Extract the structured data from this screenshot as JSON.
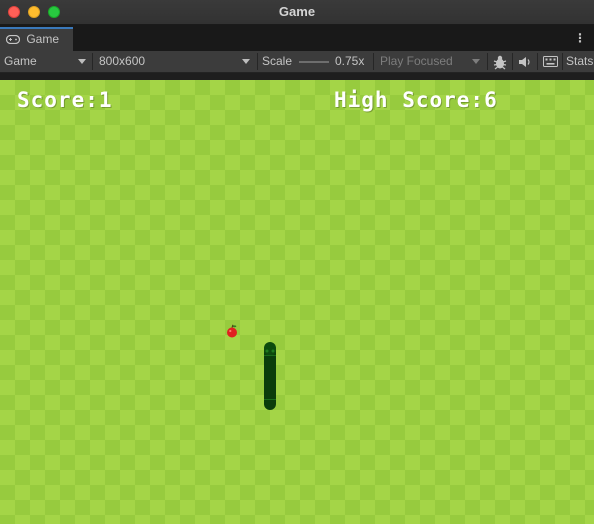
{
  "window": {
    "title": "Game"
  },
  "tabs": [
    {
      "label": "Game",
      "icon": "gamepad-icon"
    }
  ],
  "toolbar": {
    "display_selected": "Game",
    "resolution_selected": "800x600",
    "scale_label": "Scale",
    "scale_value": "0.75x",
    "play_mode_selected": "Play Focused",
    "stats_label": "Stats"
  },
  "game": {
    "score_text": "Score:1",
    "high_score_text": "High Score:6",
    "score": 1,
    "high_score": 6
  },
  "colors": {
    "grass_light": "#a4d547",
    "grass_dark": "#97cb3e",
    "snake": "#0b3d0b",
    "apple": "#e02020",
    "tab_accent": "#3a79bb"
  }
}
